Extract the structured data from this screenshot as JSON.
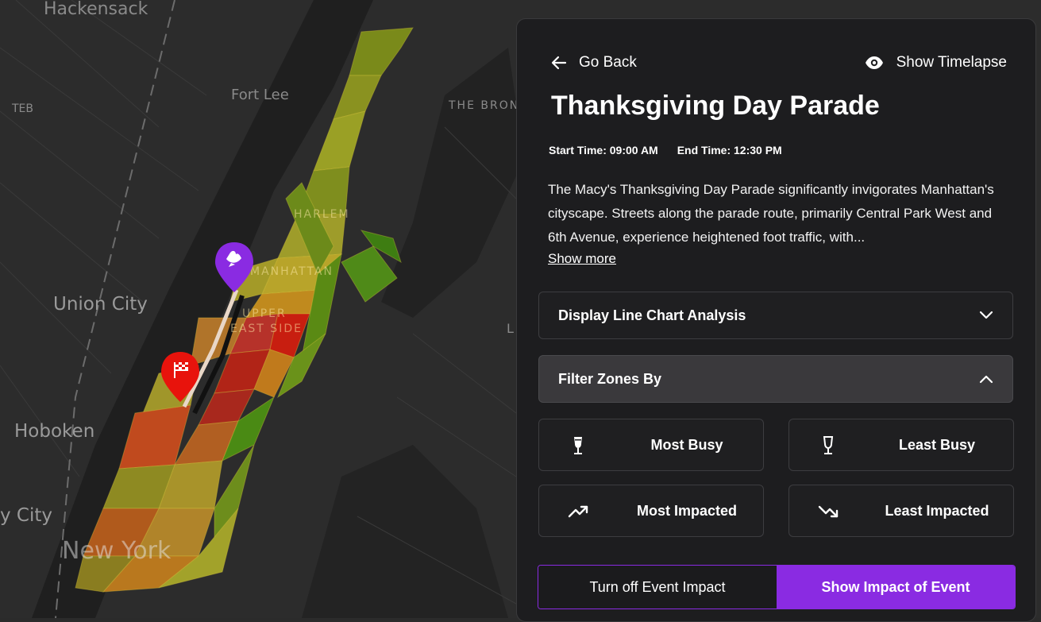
{
  "map": {
    "labels": {
      "hackensack": "Hackensack",
      "fort_lee": "Fort Lee",
      "teb": "TEB",
      "the_bronx": "THE BRON",
      "harlem": "HARLEM",
      "manhattan": "MANHATTAN",
      "upper": "UPPER",
      "east_side": "EAST SIDE",
      "union_city": "Union City",
      "hoboken": "Hoboken",
      "jersey_city": "y City",
      "new_york": "New York",
      "edge_l": "L"
    },
    "markers": {
      "start_icon": "dove-icon",
      "end_icon": "checkered-flag-icon"
    },
    "colors": {
      "busy_high": "#d61d0c",
      "busy_mid": "#c8a21c",
      "busy_low": "#3d8a14",
      "start_marker": "#8a2be2",
      "end_marker": "#e8130c"
    }
  },
  "panel": {
    "go_back": "Go Back",
    "show_timelapse": "Show Timelapse",
    "title": "Thanksgiving Day Parade",
    "start_time": "Start Time: 09:00 AM",
    "end_time": "End Time: 12:30 PM",
    "description": "The Macy's Thanksgiving Day Parade significantly invigorates Manhattan's cityscape. Streets along the parade route, primarily Central Park West and 6th Avenue, experience heightened foot traffic, with...",
    "show_more": "Show more",
    "line_chart_accordion": "Display Line Chart Analysis",
    "filter_accordion": "Filter Zones By",
    "filters": {
      "most_busy": "Most Busy",
      "least_busy": "Least Busy",
      "most_impacted": "Most Impacted",
      "least_impacted": "Least Impacted"
    },
    "toggle": {
      "off_label": "Turn off Event Impact",
      "on_label": "Show Impact of Event"
    },
    "accent_color": "#8a2be2"
  }
}
